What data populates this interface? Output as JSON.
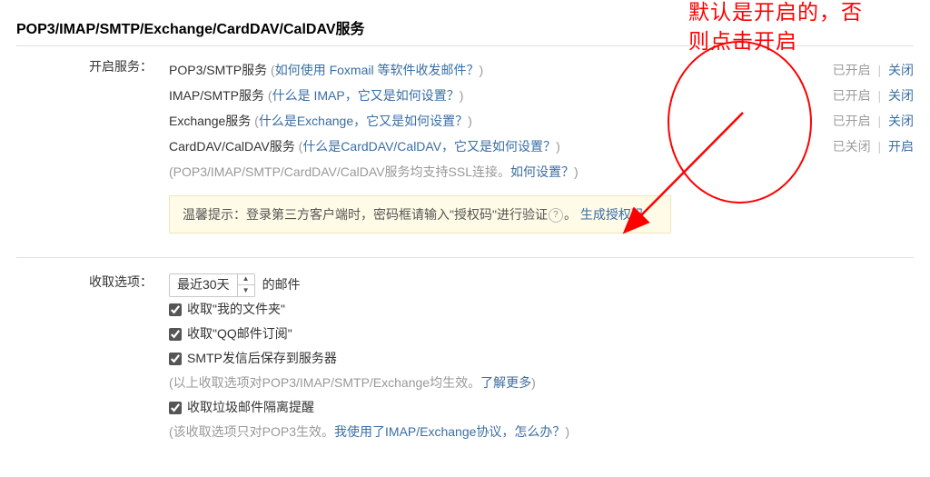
{
  "section_title": "POP3/IMAP/SMTP/Exchange/CardDAV/CalDAV服务",
  "labels": {
    "enable_service": "开启服务：",
    "receive_options": "收取选项："
  },
  "services": [
    {
      "name": "POP3/SMTP服务",
      "help_text": "如何使用 Foxmail 等软件收发邮件？",
      "status": "已开启",
      "action": "关闭"
    },
    {
      "name": "IMAP/SMTP服务",
      "help_text": "什么是 IMAP，它又是如何设置？",
      "status": "已开启",
      "action": "关闭"
    },
    {
      "name": "Exchange服务",
      "help_text": "什么是Exchange，它又是如何设置？",
      "status": "已开启",
      "action": "关闭"
    },
    {
      "name": "CardDAV/CalDAV服务",
      "help_text": "什么是CardDAV/CalDAV，它又是如何设置？",
      "status": "已关闭",
      "action": "开启"
    }
  ],
  "ssl_note_prefix": "(POP3/IMAP/SMTP/CardDAV/CalDAV服务均支持SSL连接。",
  "ssl_note_link": "如何设置？",
  "ssl_note_suffix": ")",
  "tip": {
    "prefix": "温馨提示：登录第三方客户端时，密码框请输入\"授权码\"进行验证",
    "period": "。",
    "link": "生成授权码"
  },
  "receive": {
    "select_value": "最近30天",
    "suffix": "的邮件",
    "checkboxes": [
      {
        "label": "收取\"我的文件夹\"",
        "checked": true
      },
      {
        "label": "收取\"QQ邮件订阅\"",
        "checked": true
      },
      {
        "label": "SMTP发信后保存到服务器",
        "checked": true
      }
    ],
    "note1_gray": "(以上收取选项对POP3/IMAP/SMTP/Exchange均生效。",
    "note1_link": "了解更多",
    "note1_suffix": ")",
    "checkbox4": {
      "label": "收取垃圾邮件隔离提醒",
      "checked": true
    },
    "note2_gray": "(该收取选项只对POP3生效。",
    "note2_link": "我使用了IMAP/Exchange协议，怎么办？",
    "note2_suffix": ")"
  },
  "annotation": {
    "line1": "默认是开启的，否",
    "line2": "则点击开启"
  }
}
